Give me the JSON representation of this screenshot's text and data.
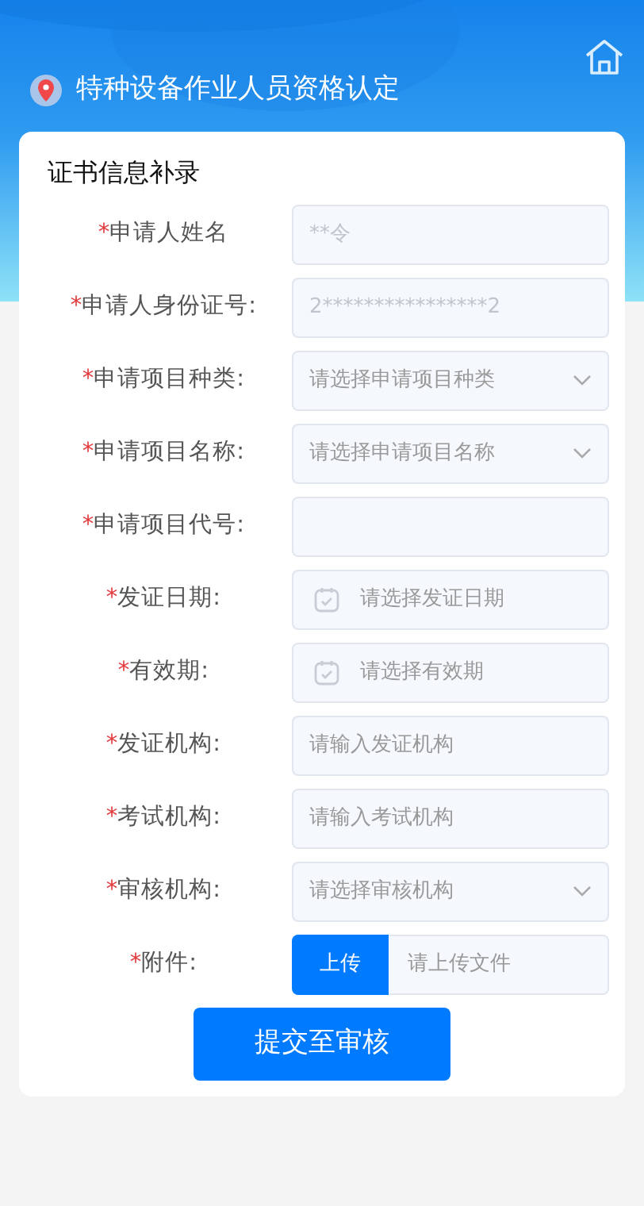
{
  "header": {
    "title": "特种设备作业人员资格认定"
  },
  "form": {
    "title": "证书信息补录",
    "fields": [
      {
        "kind": "text",
        "mark": "*",
        "label": "申请人姓名",
        "value": "**令"
      },
      {
        "kind": "text",
        "mark": "*",
        "label": "申请人身份证号:",
        "value": "2****************2"
      },
      {
        "kind": "select",
        "mark": "*",
        "label": "申请项目种类:",
        "placeholder": "请选择申请项目种类"
      },
      {
        "kind": "select",
        "mark": "*",
        "label": "申请项目名称:",
        "placeholder": "请选择申请项目名称"
      },
      {
        "kind": "text",
        "mark": "*",
        "label": "申请项目代号:"
      },
      {
        "kind": "date",
        "mark": "*",
        "label": "发证日期:",
        "placeholder": "请选择发证日期"
      },
      {
        "kind": "date",
        "mark": "*",
        "label": "有效期:",
        "placeholder": "请选择有效期"
      },
      {
        "kind": "text",
        "mark": "*",
        "label": "发证机构:",
        "placeholder": "请输入发证机构"
      },
      {
        "kind": "text",
        "mark": "*",
        "label": "考试机构:",
        "placeholder": "请输入考试机构"
      },
      {
        "kind": "select",
        "mark": "*",
        "label": "审核机构:",
        "placeholder": "请选择审核机构"
      },
      {
        "kind": "upload",
        "mark": "*",
        "label": "附件:",
        "button": "上传",
        "placeholder": "请上传文件"
      }
    ],
    "submit": "提交至审核"
  }
}
